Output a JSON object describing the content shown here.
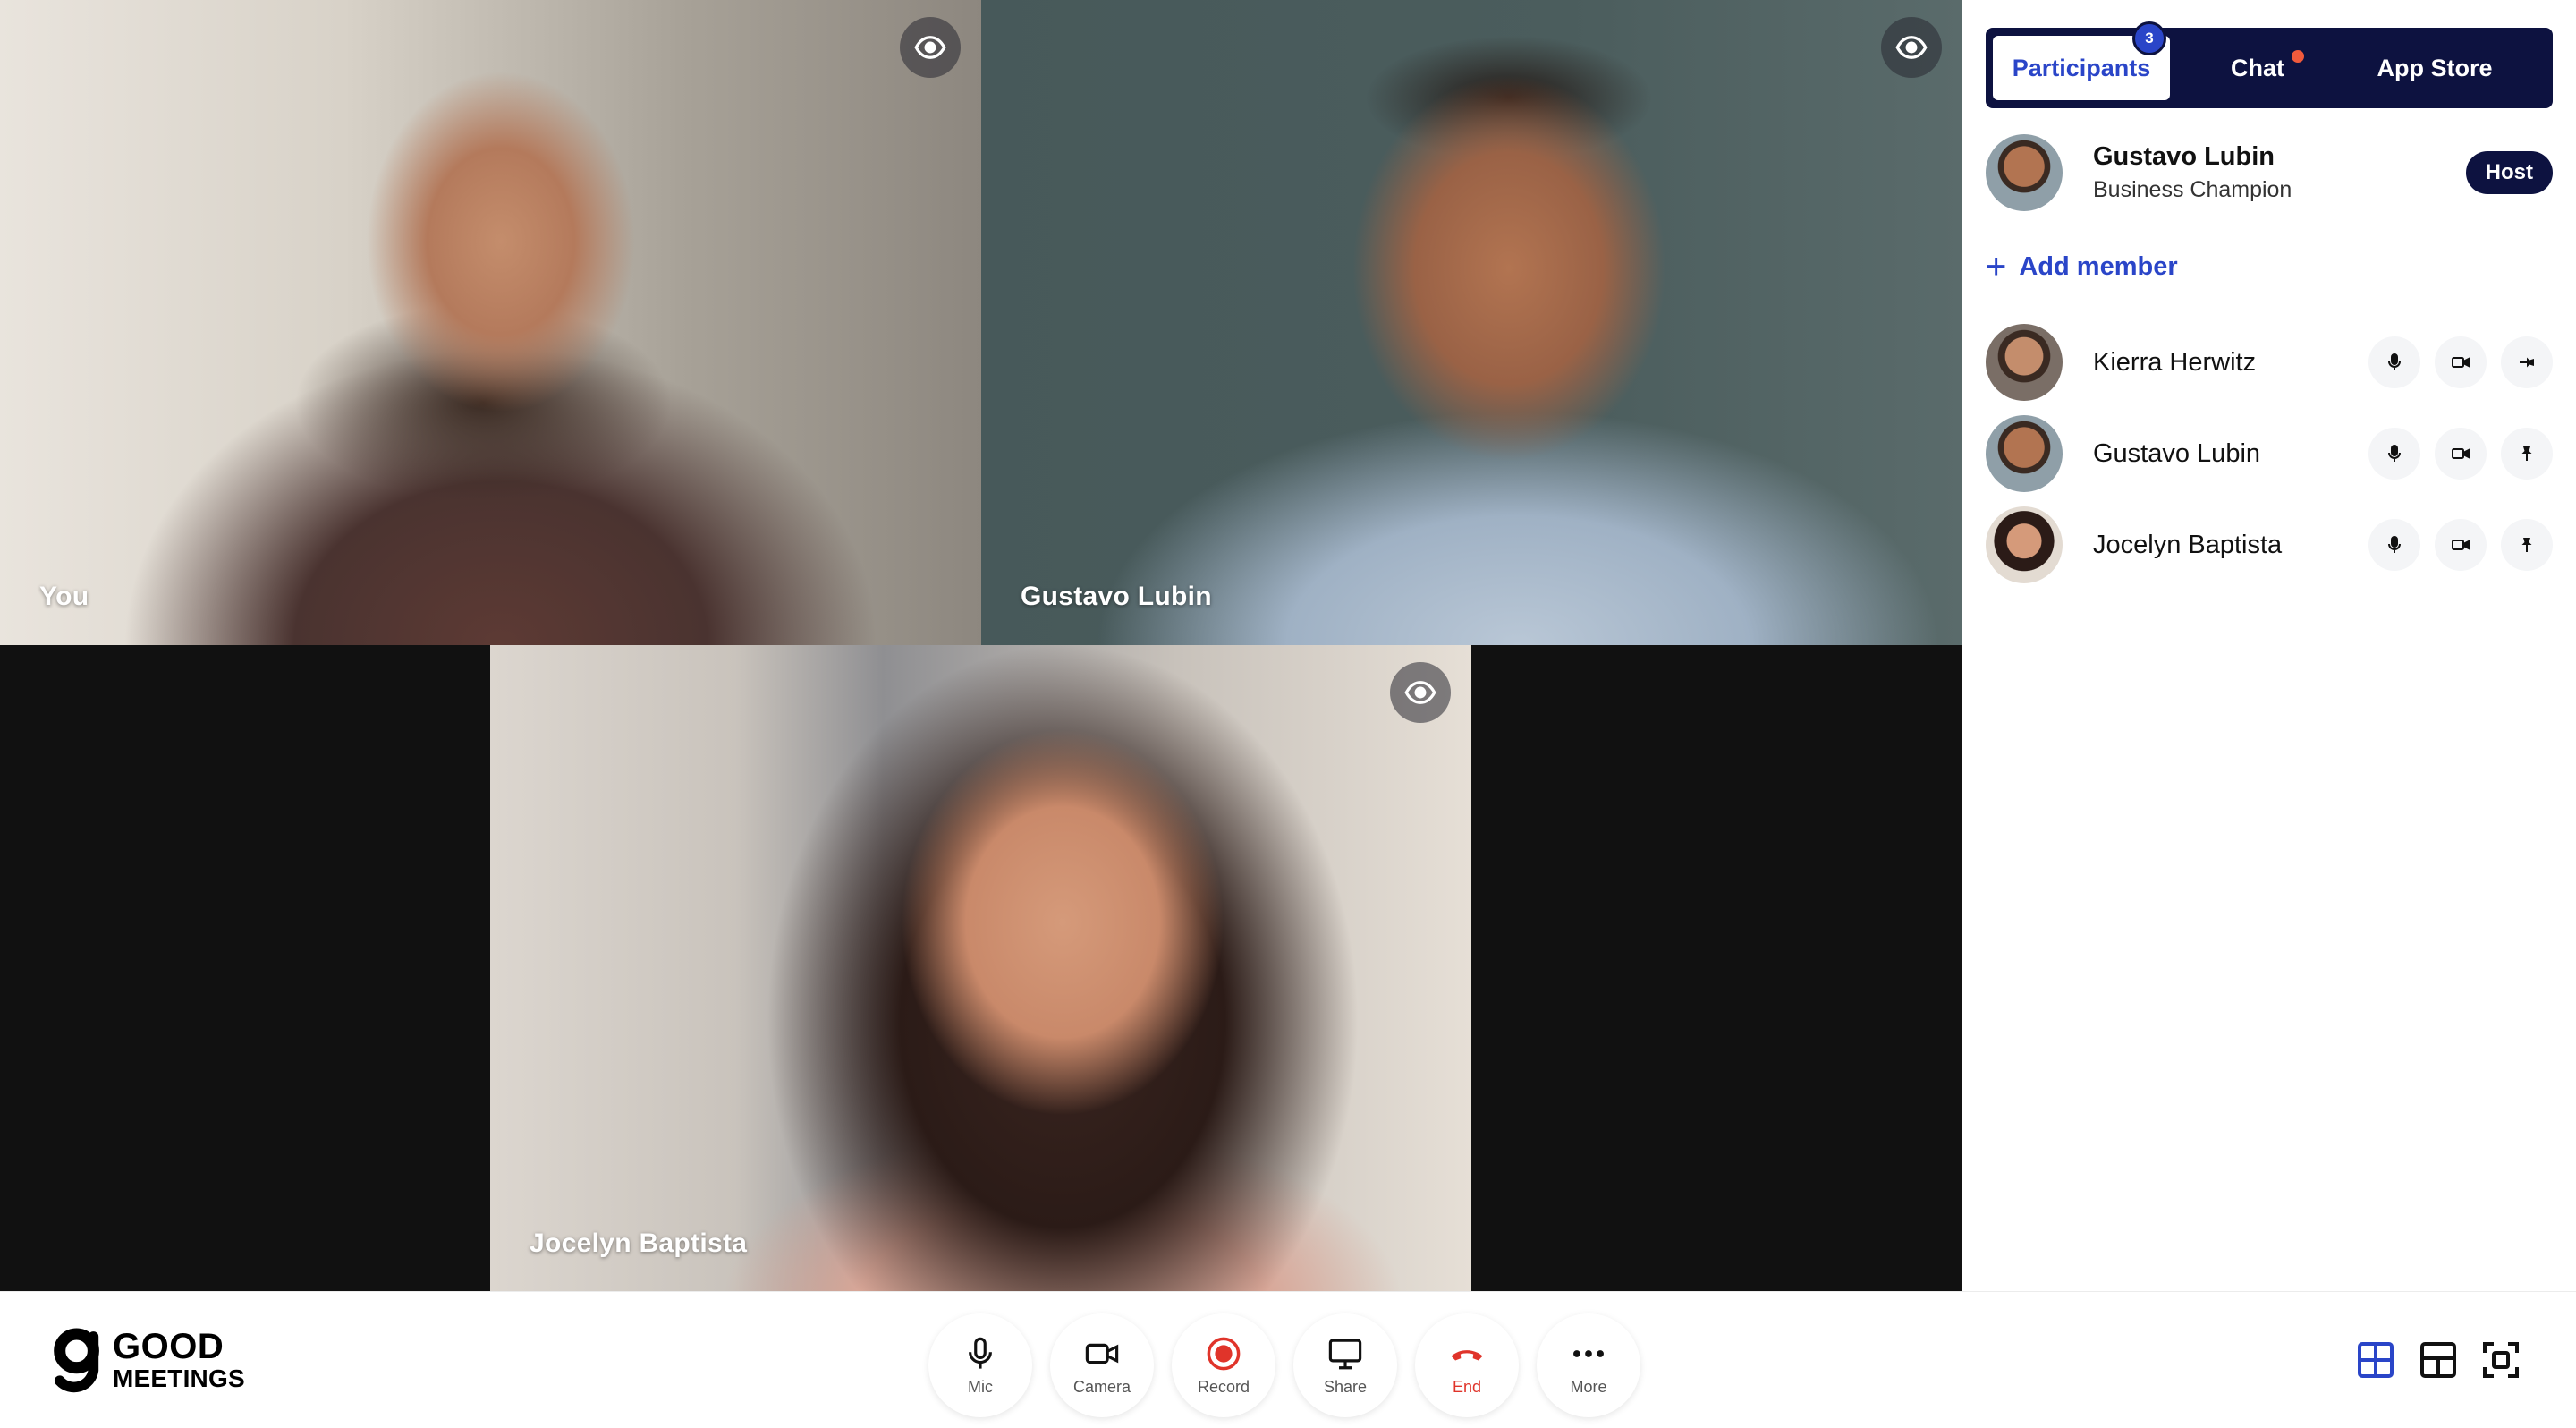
{
  "tiles": [
    {
      "name": "You"
    },
    {
      "name": "Gustavo Lubin"
    },
    {
      "name": "Jocelyn Baptista"
    }
  ],
  "sidebar": {
    "tabs": [
      {
        "label": "Participants",
        "badge": "3",
        "active": true
      },
      {
        "label": "Chat",
        "has_dot": true
      },
      {
        "label": "App Store"
      }
    ],
    "host": {
      "name": "Gustavo Lubin",
      "role": "Business Champion",
      "pill": "Host"
    },
    "add_member_label": "Add member",
    "members": [
      {
        "name": "Kierra Herwitz"
      },
      {
        "name": "Gustavo Lubin"
      },
      {
        "name": "Jocelyn Baptista"
      }
    ]
  },
  "bottombar": {
    "logo": {
      "line1": "GOOD",
      "line2": "MEETINGS"
    },
    "controls": {
      "mic": "Mic",
      "camera": "Camera",
      "record": "Record",
      "share": "Share",
      "end": "End",
      "more": "More"
    }
  },
  "colors": {
    "accent": "#2a45c8",
    "navy": "#0d1240",
    "end": "#e0342a",
    "chat_dot": "#f05a3c"
  }
}
